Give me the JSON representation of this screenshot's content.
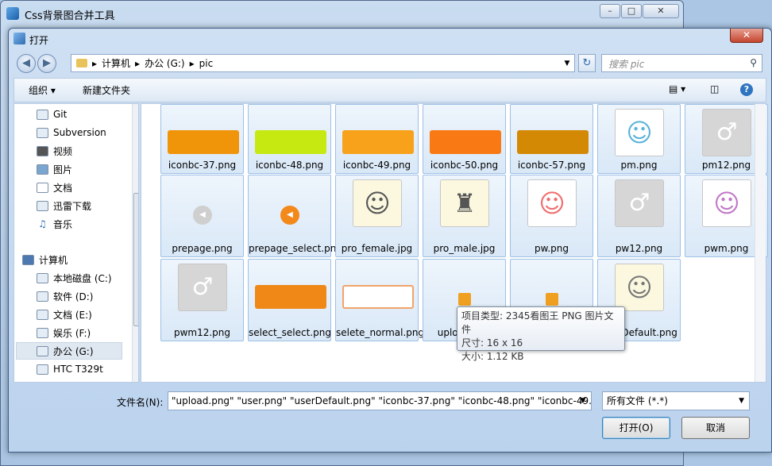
{
  "parent_window": {
    "title": "Css背景图合并工具"
  },
  "dialog": {
    "title": "打开",
    "breadcrumb": [
      "计算机",
      "办公 (G:)",
      "pic"
    ],
    "search_placeholder": "搜索 pic",
    "toolbar": {
      "organize": "组织 ▾",
      "new_folder": "新建文件夹"
    },
    "sidebar": [
      {
        "label": "Git",
        "icon": "folder-icon"
      },
      {
        "label": "Subversion",
        "icon": "folder-icon"
      },
      {
        "label": "视频",
        "icon": "video-icon"
      },
      {
        "label": "图片",
        "icon": "picture-icon"
      },
      {
        "label": "文档",
        "icon": "document-icon"
      },
      {
        "label": "迅雷下载",
        "icon": "download-icon"
      },
      {
        "label": "音乐",
        "icon": "music-icon"
      },
      {
        "label": "计算机",
        "icon": "computer-icon"
      },
      {
        "label": "本地磁盘 (C:)",
        "icon": "drive-icon"
      },
      {
        "label": "软件 (D:)",
        "icon": "drive-icon"
      },
      {
        "label": "文档 (E:)",
        "icon": "drive-icon"
      },
      {
        "label": "娱乐 (F:)",
        "icon": "drive-icon"
      },
      {
        "label": "办公 (G:)",
        "icon": "drive-icon"
      },
      {
        "label": "HTC T329t",
        "icon": "phone-icon"
      }
    ],
    "files": [
      {
        "name": "iconbc-37.png",
        "thumb": "bar",
        "color": "#f0940a"
      },
      {
        "name": "iconbc-48.png",
        "thumb": "bar",
        "color": "#c6ea11"
      },
      {
        "name": "iconbc-49.png",
        "thumb": "bar",
        "color": "#f7a21a"
      },
      {
        "name": "iconbc-50.png",
        "thumb": "bar",
        "color": "#f97a15"
      },
      {
        "name": "iconbc-57.png",
        "thumb": "bar",
        "color": "#d48905"
      },
      {
        "name": "pm.png",
        "thumb": "avatar-add",
        "color": "#5bb3d9"
      },
      {
        "name": "pm12.png",
        "thumb": "gender",
        "color": "#bdbdbd"
      },
      {
        "name": "prepage.png",
        "thumb": "arrow",
        "color": "#cfcfcf"
      },
      {
        "name": "prepage_select.png",
        "thumb": "arrow",
        "color": "#f3891a"
      },
      {
        "name": "pro_female.jpg",
        "thumb": "person",
        "color": "#555555"
      },
      {
        "name": "pro_male.jpg",
        "thumb": "hat-person",
        "color": "#555555"
      },
      {
        "name": "pw.png",
        "thumb": "avatar-add",
        "color": "#ef6d6d"
      },
      {
        "name": "pw12.png",
        "thumb": "gender",
        "color": "#bdbdbd"
      },
      {
        "name": "pwm.png",
        "thumb": "avatar-add",
        "color": "#c178c7"
      },
      {
        "name": "pwm12.png",
        "thumb": "gender",
        "color": "#bdbdbd"
      },
      {
        "name": "select_select.png",
        "thumb": "bar",
        "color": "#ef8817"
      },
      {
        "name": "selete_normal.png",
        "thumb": "outline-bar",
        "color": "#f1a46a"
      },
      {
        "name": "upload.png",
        "thumb": "small",
        "color": "#f0a020"
      },
      {
        "name": "user.png",
        "thumb": "small",
        "color": "#f0a020"
      },
      {
        "name": "userDefault.png",
        "thumb": "person",
        "color": "#777777"
      }
    ],
    "tooltip": {
      "type": "项目类型: 2345看图王 PNG 图片文件",
      "dim": "尺寸: 16 x 16",
      "size": "大小: 1.12 KB"
    },
    "filename_label": "文件名(N):",
    "filename_value": "\"upload.png\" \"user.png\" \"userDefault.png\" \"iconbc-37.png\" \"iconbc-48.png\" \"iconbc-49.",
    "filter_value": "所有文件 (*.*)",
    "open_button": "打开(O)",
    "cancel_button": "取消"
  }
}
